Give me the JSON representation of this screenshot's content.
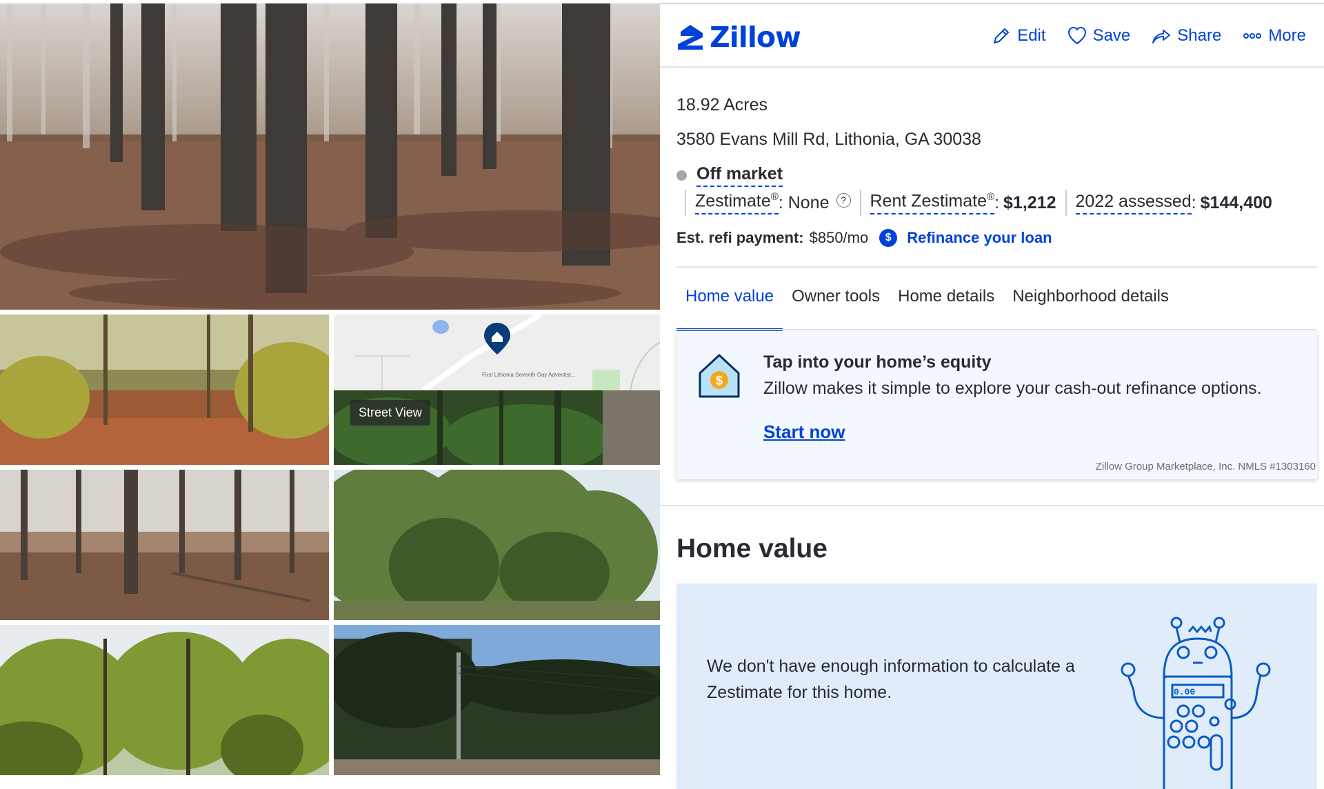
{
  "gallery": {
    "street_view_label": "Street View",
    "map_labels": {
      "church": "First Lithonia Seventh-Day Adventist..."
    }
  },
  "header": {
    "brand": "Zillow",
    "actions": [
      {
        "label": "Edit",
        "icon": "pencil-icon"
      },
      {
        "label": "Save",
        "icon": "heart-icon"
      },
      {
        "label": "Share",
        "icon": "share-arrow-icon"
      },
      {
        "label": "More",
        "icon": "ellipsis-icon"
      }
    ]
  },
  "property": {
    "facts": "18.92 Acres",
    "address": "3580 Evans Mill Rd, Lithonia, GA 30038",
    "status": "Off market",
    "zestimate": {
      "label": "Zestimate",
      "sup": "®",
      "value": ": None"
    },
    "rent_zestimate": {
      "label": "Rent Zestimate",
      "sup": "®",
      "value": "$1,212"
    },
    "assessed": {
      "label": "2022 assessed",
      "value": "$144,400"
    },
    "refi": {
      "label": "Est. refi payment:",
      "value": "$850/mo",
      "link": "Refinance your loan"
    }
  },
  "tabs": [
    {
      "label": "Home value",
      "active": true
    },
    {
      "label": "Owner tools",
      "active": false
    },
    {
      "label": "Home details",
      "active": false
    },
    {
      "label": "Neighborhood details",
      "active": false
    }
  ],
  "equity_card": {
    "title": "Tap into your home’s equity",
    "description": "Zillow makes it simple to explore your cash-out refinance options.",
    "cta": "Start now",
    "disclaimer": "Zillow Group Marketplace, Inc. NMLS #1303160"
  },
  "home_value": {
    "heading": "Home value",
    "message": "We don't have enough information to calculate a Zestimate for this home.",
    "robot_display": "0.00"
  },
  "colors": {
    "brand_blue": "#0041d9",
    "text": "#2a2a33",
    "card_bg": "#f2f8fd",
    "hv_bg": "#e1ecfa"
  }
}
